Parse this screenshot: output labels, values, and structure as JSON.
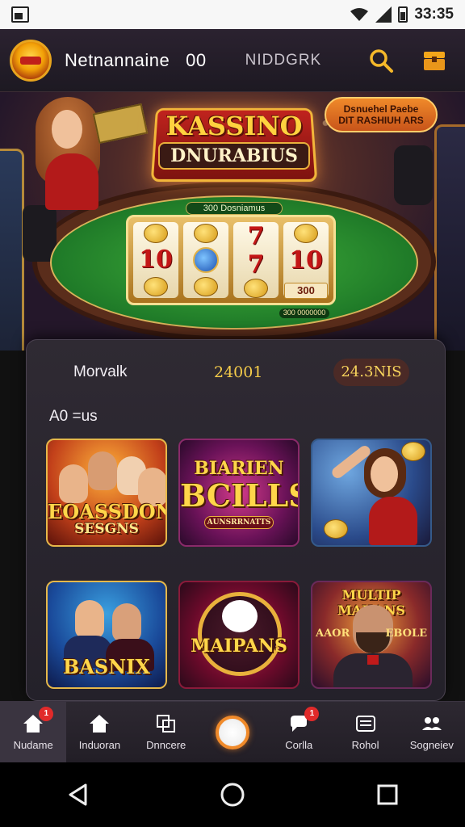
{
  "status_bar": {
    "time": "33:35"
  },
  "header": {
    "title": "Netnannaine",
    "title_suffix": "00",
    "subtitle": "NIDDGRK",
    "icons": [
      "search-icon",
      "treasure-chest-icon"
    ]
  },
  "hero": {
    "title": "KASSINO",
    "subtitle": "DNURABIUS",
    "promo_line1": "Dsnuehel Paebe",
    "promo_line2": "DIT RASHIUH ARS",
    "felt_label": "300 Dosniamus",
    "reel_symbols": [
      "10",
      "7",
      "7",
      "10"
    ],
    "bet_tag": "300",
    "bottom_tag": "300 0000000"
  },
  "panel": {
    "row_label": "Morvalk",
    "row_value": "24001",
    "row_pill": "24.3NIS",
    "section_title": "A0 =us"
  },
  "games": [
    {
      "title": "EOASSDON",
      "subtitle": "SESGNS"
    },
    {
      "title": "BIARIEN",
      "subtitle": "BCILLS",
      "caption": "AUNSRRNATTS"
    },
    {
      "title": "",
      "subtitle": ""
    },
    {
      "title": "BASNIX",
      "subtitle": ""
    },
    {
      "title": "MAIPANS",
      "subtitle": ""
    },
    {
      "title": "MULTIP MAHANS",
      "side_left": "AAOR",
      "side_right": "EBOLE"
    }
  ],
  "bottom_nav": {
    "items": [
      {
        "label": "Nudame",
        "icon": "home-icon",
        "badge": "1"
      },
      {
        "label": "Induoran",
        "icon": "home-icon",
        "badge": ""
      },
      {
        "label": "Dnncere",
        "icon": "copy-icon",
        "badge": ""
      },
      {
        "label": "",
        "icon": "play-center-icon",
        "badge": ""
      },
      {
        "label": "Corlla",
        "icon": "chat-icon",
        "badge": "1"
      },
      {
        "label": "Rohol",
        "icon": "wallet-icon",
        "badge": ""
      },
      {
        "label": "Sogneiev",
        "icon": "users-icon",
        "badge": ""
      }
    ]
  },
  "colors": {
    "accent": "#f08a2a",
    "gold": "#f5cc4a",
    "panel": "#2f2a33"
  }
}
